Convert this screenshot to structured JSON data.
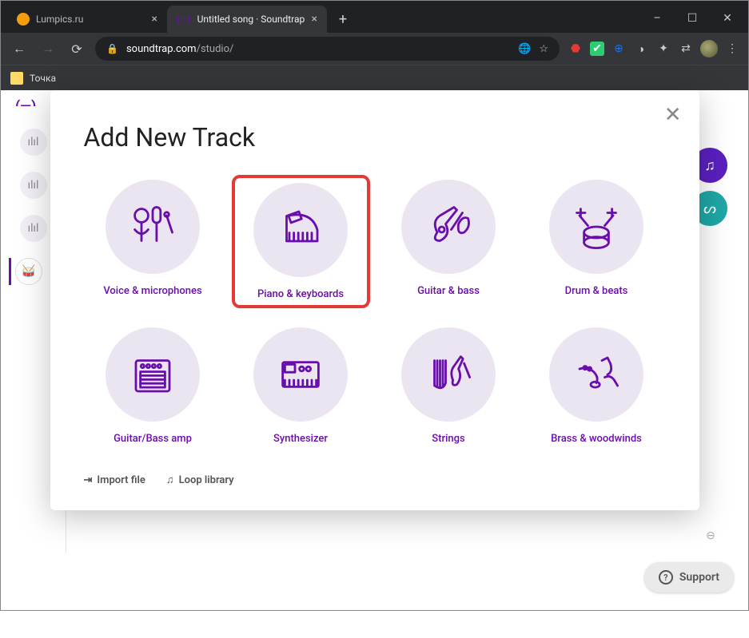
{
  "window": {
    "minimize": "–",
    "maximize": "☐",
    "close": "✕"
  },
  "tabs": [
    {
      "title": "Lumpics.ru",
      "active": false,
      "iconColor": "#f59e0b"
    },
    {
      "title": "Untitled song · Soundtrap",
      "active": true,
      "iconText": "(—)"
    }
  ],
  "addTab": "+",
  "nav": {
    "back": "←",
    "forward": "→",
    "reload": "⟳"
  },
  "url": {
    "lock": "🔒",
    "domain": "soundtrap.com",
    "path": "/studio/"
  },
  "omni_icons": [
    "🌐",
    "☆"
  ],
  "extensions": [
    {
      "glyph": "⬣",
      "color": "#e53935"
    },
    {
      "glyph": "✔",
      "color": "#2ecc71"
    },
    {
      "glyph": "⊕",
      "color": "#1a73e8"
    },
    {
      "glyph": "◑",
      "color": "#555"
    },
    {
      "glyph": "✦",
      "color": "#555"
    },
    {
      "glyph": "⇄",
      "color": "#aaa"
    }
  ],
  "menu": "⋮",
  "bookmark": {
    "label": "Точка"
  },
  "app": {
    "logo": "(—)"
  },
  "sidebar": [
    {
      "icon": "ılıl"
    },
    {
      "icon": "ılıl"
    },
    {
      "icon": "ılıl"
    },
    {
      "icon": "🥁",
      "selected": true
    }
  ],
  "fabs": [
    {
      "icon": "♫"
    },
    {
      "icon": "ᔕ"
    }
  ],
  "modal": {
    "title": "Add New Track",
    "close": "✕",
    "tiles": [
      {
        "label": "Voice & microphones",
        "highlight": false,
        "icon": "mic"
      },
      {
        "label": "Piano & keyboards",
        "highlight": true,
        "icon": "piano"
      },
      {
        "label": "Guitar & bass",
        "highlight": false,
        "icon": "guitar"
      },
      {
        "label": "Drum & beats",
        "highlight": false,
        "icon": "drums"
      },
      {
        "label": "Guitar/Bass amp",
        "highlight": false,
        "icon": "amp"
      },
      {
        "label": "Synthesizer",
        "highlight": false,
        "icon": "synth"
      },
      {
        "label": "Strings",
        "highlight": false,
        "icon": "strings"
      },
      {
        "label": "Brass & woodwinds",
        "highlight": false,
        "icon": "brass"
      }
    ],
    "footer": {
      "import": "Import file",
      "importIcon": "⇥",
      "loop": "Loop library",
      "loopIcon": "♫"
    }
  },
  "support": {
    "label": "Support",
    "icon": "?"
  },
  "zoom": "⊖"
}
